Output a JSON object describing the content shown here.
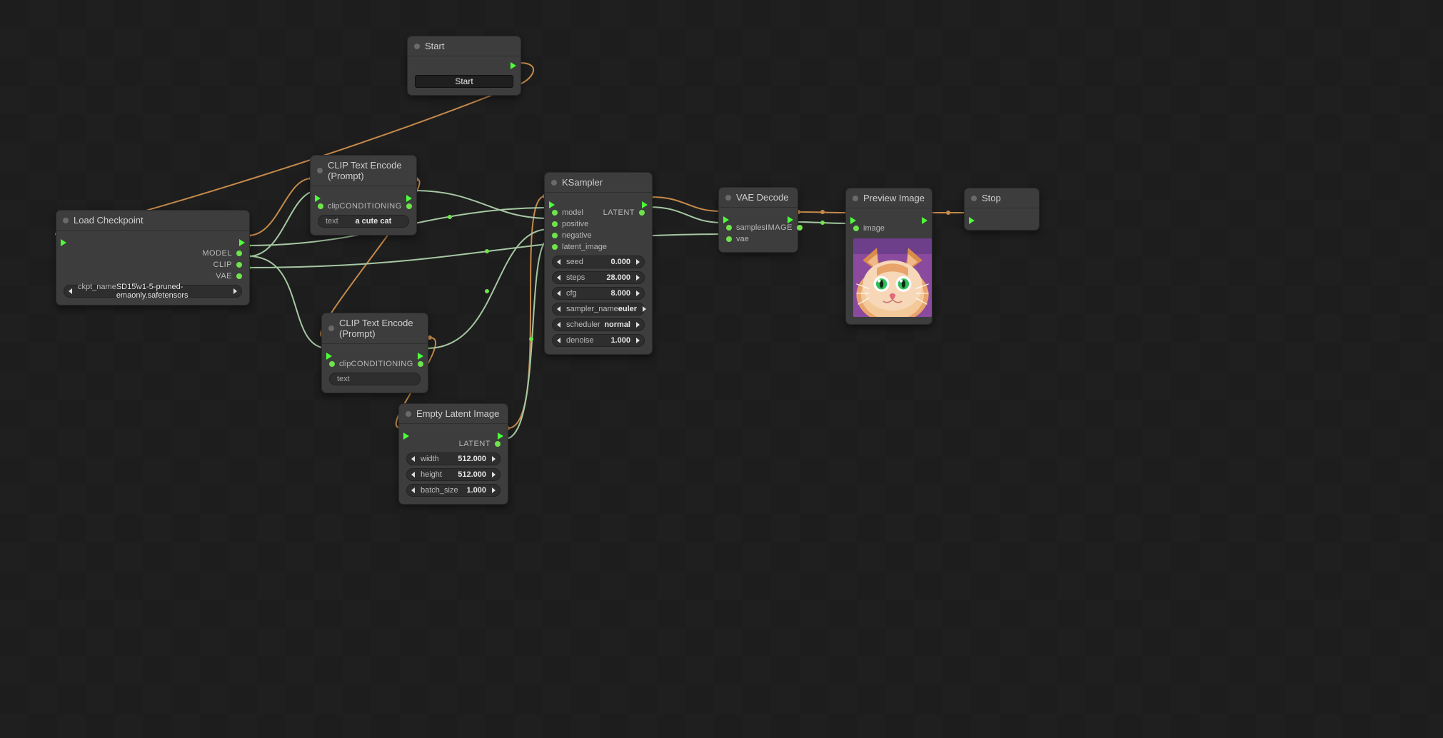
{
  "nodes": {
    "start": {
      "title": "Start",
      "button": "Start"
    },
    "load_checkpoint": {
      "title": "Load Checkpoint",
      "outputs": {
        "model": "MODEL",
        "clip": "CLIP",
        "vae": "VAE"
      },
      "ckpt_label": "ckpt_name",
      "ckpt_value": "SD15\\v1-5-pruned-emaonly.safetensors"
    },
    "clip_pos": {
      "title": "CLIP Text Encode (Prompt)",
      "in_clip": "clip",
      "out_cond": "CONDITIONING",
      "text_label": "text",
      "text_value": "a cute cat"
    },
    "clip_neg": {
      "title": "CLIP Text Encode (Prompt)",
      "in_clip": "clip",
      "out_cond": "CONDITIONING",
      "text_label": "text",
      "text_value": ""
    },
    "empty_latent": {
      "title": "Empty Latent Image",
      "out": "LATENT",
      "width_label": "width",
      "width_value": "512.000",
      "height_label": "height",
      "height_value": "512.000",
      "batch_label": "batch_size",
      "batch_value": "1.000"
    },
    "ksampler": {
      "title": "KSampler",
      "inputs": {
        "model": "model",
        "positive": "positive",
        "negative": "negative",
        "latent_image": "latent_image"
      },
      "out": "LATENT",
      "seed_label": "seed",
      "seed_value": "0.000",
      "steps_label": "steps",
      "steps_value": "28.000",
      "cfg_label": "cfg",
      "cfg_value": "8.000",
      "sampler_label": "sampler_name",
      "sampler_value": "euler",
      "scheduler_label": "scheduler",
      "scheduler_value": "normal",
      "denoise_label": "denoise",
      "denoise_value": "1.000"
    },
    "vae_decode": {
      "title": "VAE Decode",
      "in_samples": "samples",
      "in_vae": "vae",
      "out": "IMAGE"
    },
    "preview": {
      "title": "Preview Image",
      "in_image": "image"
    },
    "stop": {
      "title": "Stop"
    }
  }
}
